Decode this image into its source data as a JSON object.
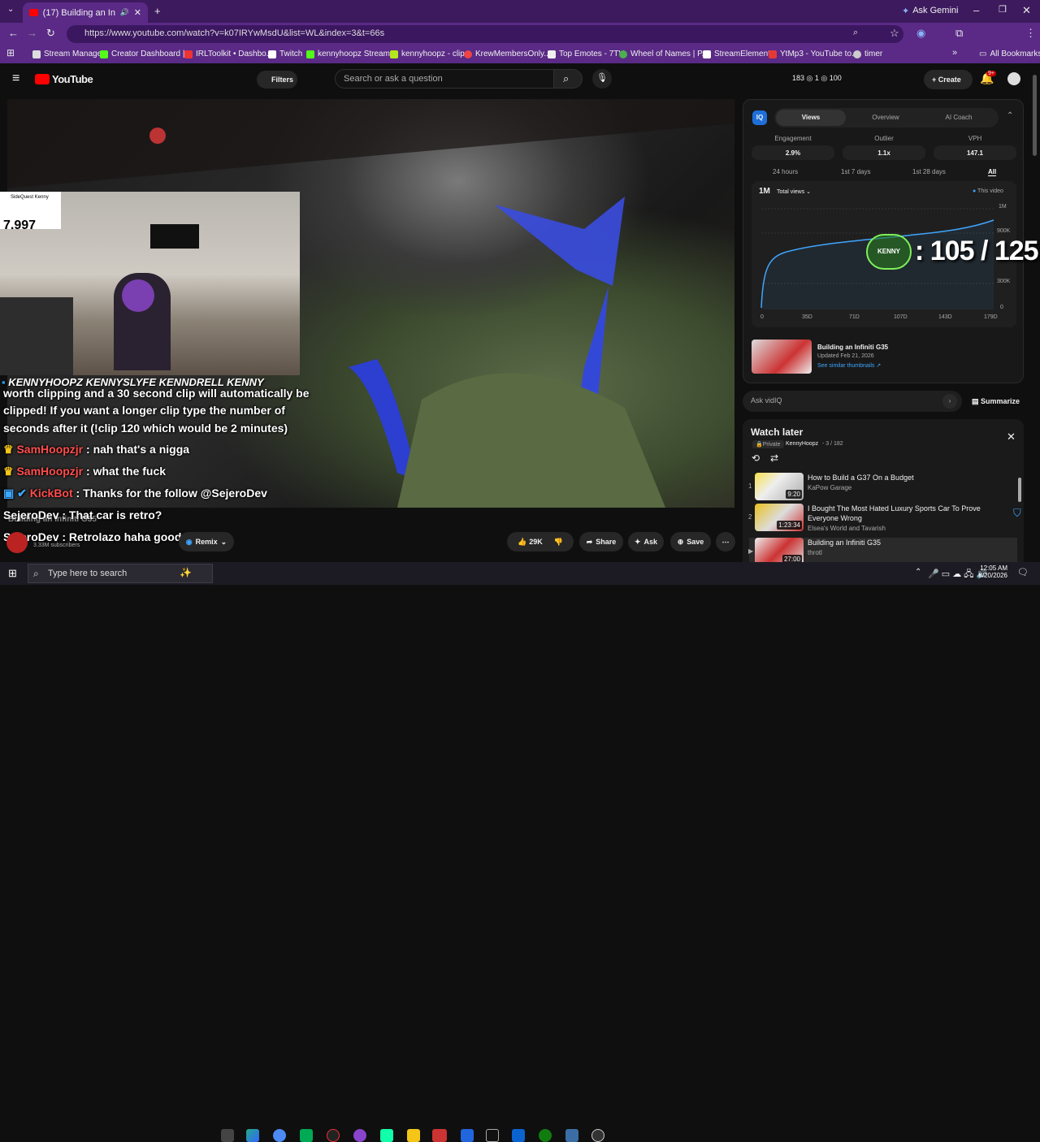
{
  "browser": {
    "tab_title": "(17) Building an Infiniti G35",
    "ask_gemini": "Ask Gemini",
    "url": "https://www.youtube.com/watch?v=k07IRYwMsdU&list=WL&index=3&t=66s",
    "bookmarks": [
      "Stream Manager",
      "Creator Dashboard |...",
      "IRLToolkit • Dashbo...",
      "Twitch",
      "kennyhoopz Stream...",
      "kennyhoopz - clips",
      "KrewMembersOnly...",
      "Top Emotes - 7TV",
      "Wheel of Names | P...",
      "StreamElements",
      "YtMp3 - YouTube to...",
      "timer"
    ],
    "all_bookmarks": "All Bookmarks"
  },
  "youtube": {
    "logo": "YouTube",
    "filters": "Filters",
    "search_placeholder": "Search or ask a question",
    "stats": "183  ◎ 1  ◎ 100",
    "create": "Create",
    "notif_count": "9+"
  },
  "stream_overlay": {
    "cam_label": "SideQuest Kenny",
    "cam_number": "7,997",
    "socials": "KENNYHOOPZ  KENNYSLYFE  KENNDRELL  KENNY",
    "chat": [
      {
        "user": "",
        "text": "worth clipping and a 30 second clip will automatically be"
      },
      {
        "user": "",
        "text": "clipped! If you want a longer clip type the number of"
      },
      {
        "user": "",
        "text": "seconds after it (!clip 120 which would be 2 minutes)"
      },
      {
        "user": "SamHoopzjr",
        "text": ": nah that's a nigga"
      },
      {
        "user": "SamHoopzjr",
        "text": ": what the fuck"
      },
      {
        "user": "KickBot",
        "text": ": Thanks for the follow @SejeroDev"
      },
      {
        "user": "SejeroDev",
        "text": ": That car is retro?"
      },
      {
        "user": "SejeroDev",
        "text": ": Retrolazo haha good one"
      }
    ],
    "counter": ": 105 / 125"
  },
  "video": {
    "title": "Building an Infiniti G35",
    "subscribers": "3.33M subscribers",
    "likes": "29K",
    "share": "Share",
    "ask": "Ask",
    "save": "Save",
    "remix": "Remix"
  },
  "vidiq": {
    "tabs": [
      "Views",
      "Overview",
      "AI Coach"
    ],
    "stats": [
      {
        "label": "Engagement",
        "value": "2.9%"
      },
      {
        "label": "Outlier",
        "value": "1.1x"
      },
      {
        "label": "VPH",
        "value": "147.1"
      }
    ],
    "ranges": [
      "24 hours",
      "1st 7 days",
      "1st 28 days",
      "All"
    ],
    "total_views": "1M",
    "total_views_label": "Total views",
    "this_video": "This video",
    "chart_y": [
      "1M",
      "900K",
      "300K",
      "0"
    ],
    "chart_x": [
      "0",
      "35D",
      "71D",
      "107D",
      "143D",
      "179D"
    ],
    "video_title": "Building an Infiniti G35",
    "updated": "Updated Feb 21, 2026",
    "similar": "See similar thumbnails ↗",
    "ask_placeholder": "Ask vidIQ",
    "summarize": "Summarize"
  },
  "watch_later": {
    "title": "Watch later",
    "privacy": "Private",
    "owner": "KennyHoopz",
    "position": "- 3 / 182",
    "items": [
      {
        "index": "1",
        "title": "How to Build a G37 On a Budget",
        "channel": "KaPow Garage",
        "duration": "9:20"
      },
      {
        "index": "2",
        "title": "I Bought The Most Hated Luxury Sports Car To Prove Everyone Wrong",
        "channel": "Elsea's World and Tavarish",
        "duration": "1:23:34"
      },
      {
        "index": "▶",
        "title": "Building an Infiniti G35",
        "channel": "throtl",
        "duration": "27:00"
      }
    ]
  },
  "taskbar": {
    "search_placeholder": "Type here to search",
    "time": "12:05 AM",
    "date": "8/20/2026"
  },
  "colors": {
    "accent": "#5a2a86",
    "youtube_red": "#ff0000",
    "vidiq_blue": "#3ea6ff"
  }
}
